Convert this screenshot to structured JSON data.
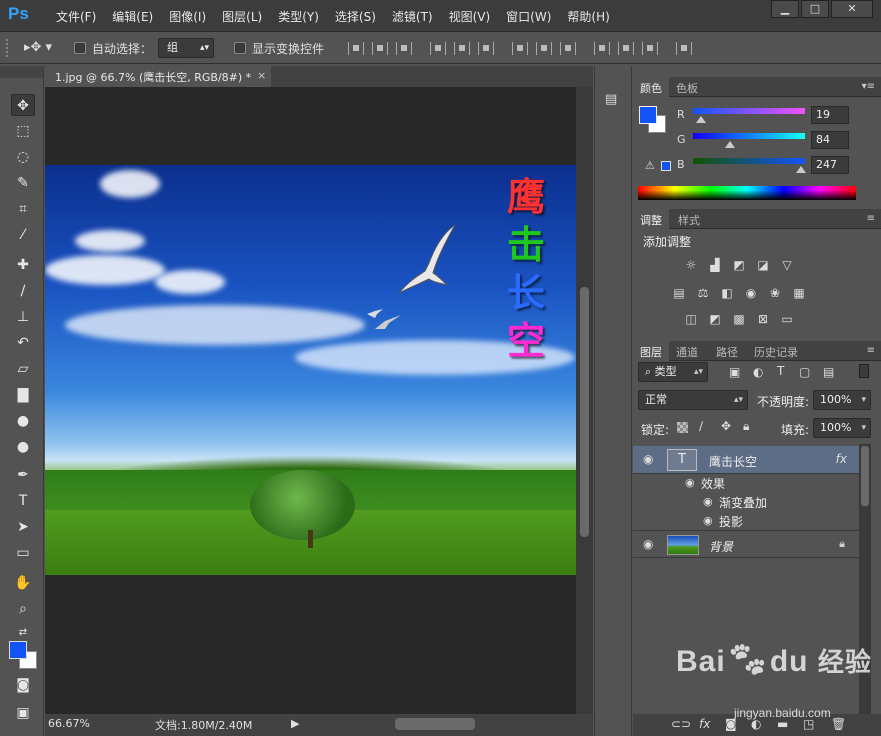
{
  "app": {
    "logo": "Ps"
  },
  "menu": [
    "文件(F)",
    "编辑(E)",
    "图像(I)",
    "图层(L)",
    "类型(Y)",
    "选择(S)",
    "滤镜(T)",
    "视图(V)",
    "窗口(W)",
    "帮助(H)"
  ],
  "window_buttons": {
    "minimize": "▁",
    "maximize": "□",
    "close": "✕"
  },
  "options": {
    "auto_select_label": "自动选择：",
    "auto_select_value": "组",
    "show_transform_label": "显示变换控件"
  },
  "document": {
    "tab_title": "1.jpg @ 66.7% (鹰击长空, RGB/8#) *",
    "tab_close": "×",
    "zoom": "66.67%",
    "doc_info": "文档:1.80M/2.40M",
    "title_chars": [
      "鹰",
      "击",
      "长",
      "空"
    ],
    "title_colors": [
      "#ff3030",
      "#1ec81e",
      "#2a6bff",
      "#ff2ad0"
    ]
  },
  "colors": {
    "foreground": "#1354f7",
    "background": "#ffffff"
  },
  "color_panel": {
    "tabs": [
      "颜色",
      "色板"
    ],
    "r_label": "R",
    "g_label": "G",
    "b_label": "B",
    "r": "19",
    "g": "84",
    "b": "247"
  },
  "adjust_panel": {
    "tabs": [
      "调整",
      "样式"
    ],
    "title": "添加调整"
  },
  "layers_panel": {
    "tabs": [
      "图层",
      "通道",
      "路径",
      "历史记录"
    ],
    "filter_kind": "类型",
    "blend_mode": "正常",
    "opacity_label": "不透明度:",
    "opacity": "100%",
    "lock_label": "锁定:",
    "fill_label": "填充:",
    "fill": "100%",
    "layers": [
      {
        "name": "鹰击长空",
        "thumb": "T",
        "fx": "fx",
        "selected": true
      },
      {
        "name": "背景",
        "locked": true
      }
    ],
    "effects_label": "效果",
    "effects": [
      "渐变叠加",
      "投影"
    ]
  },
  "watermark": {
    "brand": "Bai",
    "brand2": "du",
    "cn": "经验",
    "url": "jingyan.baidu.com"
  }
}
